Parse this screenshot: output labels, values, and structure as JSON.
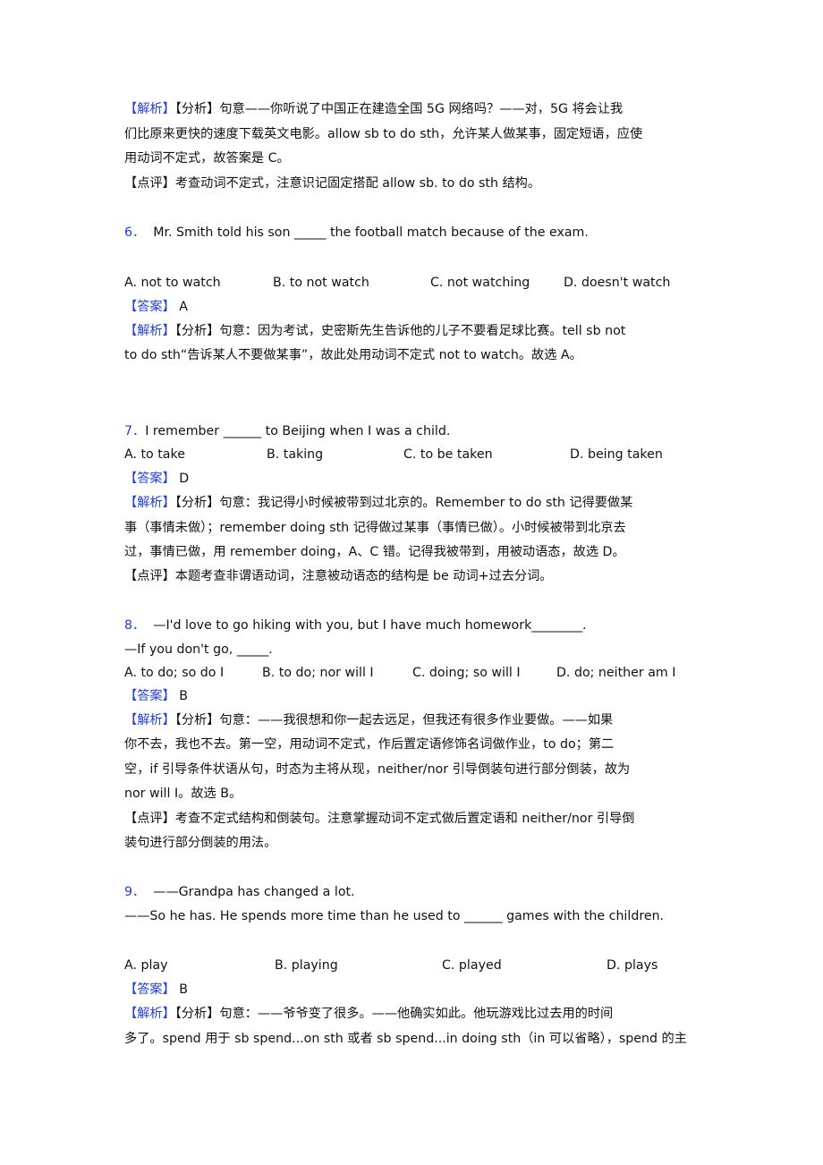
{
  "tags": {
    "analysis": "【解析】",
    "fenxi": "【分析】",
    "answer": "【答案】",
    "comment": "【点评】"
  },
  "accent_color": "#1f3fd6",
  "q5_tail": {
    "analysis_lines": [
      "句意——你听说了中国正在建造全国 5G 网络吗？——对，5G 将会让我",
      "们比原来更快的速度下载英文电影。allow sb to do sth，允许某人做某事，固定短语，应使",
      "用动词不定式，故答案是 C。"
    ],
    "comment": "考查动词不定式，注意识记固定搭配 allow sb. to do sth 结构。"
  },
  "questions": [
    {
      "number": "6．",
      "stem_lines": [
        "Mr. Smith told his son _____ the football match because of the exam."
      ],
      "options": [
        "A. not to watch",
        "B. to not watch",
        "C. not watching",
        "D. doesn't watch"
      ],
      "answer": "A",
      "analysis_lines": [
        "句意：因为考试，史密斯先生告诉他的儿子不要看足球比赛。tell sb not",
        "to do sth“告诉某人不要做某事”，故此处用动词不定式 not to watch。故选 A。"
      ]
    },
    {
      "number": "7．",
      "stem_lines": [
        "I remember ______ to Beijing when I was a child."
      ],
      "options": [
        "A. to take",
        "B. taking",
        "C. to be taken",
        "D. being taken"
      ],
      "answer": "D",
      "analysis_lines": [
        "句意：我记得小时候被带到过北京的。Remember to do sth 记得要做某",
        "事（事情未做）；remember doing sth 记得做过某事（事情已做）。小时候被带到北京去",
        "过，事情已做，用 remember doing，A、C 错。记得我被带到，用被动语态，故选 D。"
      ],
      "comment": "本题考查非谓语动词，注意被动语态的结构是 be 动词+过去分词。"
    },
    {
      "number": "8．",
      "stem_lines": [
        "—I'd love to go hiking with you, but I have much homework________.",
        "—If you don't go, _____."
      ],
      "options": [
        "A. to do; so do I",
        "B. to do; nor will I",
        "C. doing; so will I",
        "D. do; neither am I"
      ],
      "answer": "B",
      "analysis_lines": [
        "句意：——我很想和你一起去远足，但我还有很多作业要做。——如果",
        "你不去，我也不去。第一空，用动词不定式，作后置定语修饰名词做作业，to do；第二",
        "空，if 引导条件状语从句，时态为主将从现，neither/nor 引导倒装句进行部分倒装，故为",
        "nor will I。故选 B。"
      ],
      "comment_lines": [
        "考查不定式结构和倒装句。注意掌握动词不定式做后置定语和 neither/nor 引导倒",
        "装句进行部分倒装的用法。"
      ]
    },
    {
      "number": "9．",
      "stem_lines": [
        "——Grandpa has changed a lot.",
        "——So he has. He spends more time than he used to ______ games with the children."
      ],
      "options": [
        "A. play",
        "B. playing",
        "C. played",
        "D. plays"
      ],
      "answer": "B",
      "analysis_lines": [
        "句意：——爷爷变了很多。——他确实如此。他玩游戏比过去用的时间",
        "多了。spend 用于 sb spend...on sth 或者 sb spend...in doing sth（in 可以省略），spend 的主"
      ]
    }
  ]
}
